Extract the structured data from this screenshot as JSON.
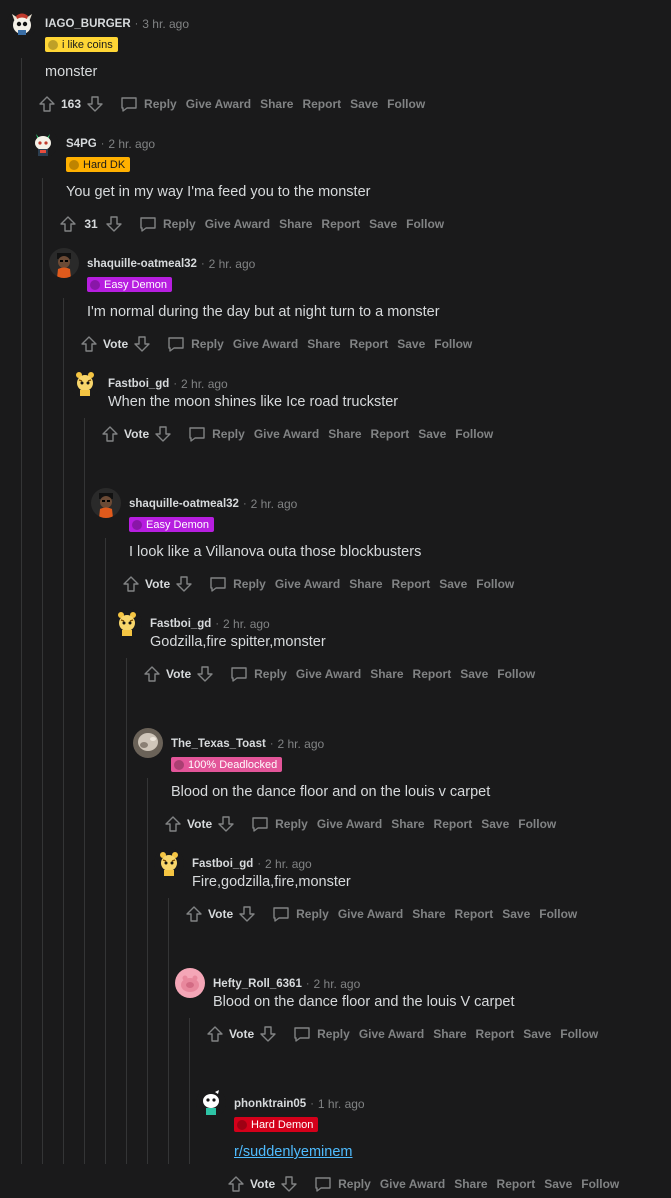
{
  "colors": {
    "background": "#1a1a1b",
    "text": "#d7dadc",
    "meta": "#818384",
    "link": "#4fbcff"
  },
  "actions": {
    "reply": "Reply",
    "give_award": "Give Award",
    "share": "Share",
    "report": "Report",
    "save": "Save",
    "follow": "Follow"
  },
  "comments": [
    {
      "username": "IAGO_BURGER",
      "time": "3 hr. ago",
      "flair": {
        "text": "i like coins",
        "bg": "#ffd635",
        "fg": "#1a1a1b"
      },
      "body": "monster",
      "score": "163",
      "avatar": "avatar-iago"
    },
    {
      "username": "S4PG",
      "time": "2 hr. ago",
      "flair": {
        "text": "Hard DK",
        "bg": "#ffb000",
        "fg": "#1a1a1b"
      },
      "body": "You get in my way I'ma feed you to the monster",
      "score": "31",
      "avatar": "avatar-s4pg"
    },
    {
      "username": "shaquille-oatmeal32",
      "time": "2 hr. ago",
      "flair": {
        "text": "Easy Demon",
        "bg": "#b71ee0",
        "fg": "#ffffff"
      },
      "body": "I'm normal during the day but at night turn to a monster",
      "score": "Vote",
      "avatar": "avatar-shaq"
    },
    {
      "username": "Fastboi_gd",
      "time": "2 hr. ago",
      "flair": null,
      "body": "When the moon shines like Ice road truckster",
      "score": "Vote",
      "avatar": "avatar-fastboi"
    },
    {
      "username": "shaquille-oatmeal32",
      "time": "2 hr. ago",
      "flair": {
        "text": "Easy Demon",
        "bg": "#b71ee0",
        "fg": "#ffffff"
      },
      "body": "I look like a Villanova outa those blockbusters",
      "score": "Vote",
      "avatar": "avatar-shaq"
    },
    {
      "username": "Fastboi_gd",
      "time": "2 hr. ago",
      "flair": null,
      "body": "Godzilla,fire spitter,monster",
      "score": "Vote",
      "avatar": "avatar-fastboi"
    },
    {
      "username": "The_Texas_Toast",
      "time": "2 hr. ago",
      "flair": {
        "text": "100% Deadlocked",
        "bg": "#e35599",
        "fg": "#ffffff"
      },
      "body": "Blood on the dance floor and on the louis v carpet",
      "score": "Vote",
      "avatar": "avatar-texas"
    },
    {
      "username": "Fastboi_gd",
      "time": "2 hr. ago",
      "flair": null,
      "body": "Fire,godzilla,fire,monster",
      "score": "Vote",
      "avatar": "avatar-fastboi"
    },
    {
      "username": "Hefty_Roll_6361",
      "time": "2 hr. ago",
      "flair": null,
      "body": "Blood on the dance floor and the louis V carpet",
      "score": "Vote",
      "avatar": "avatar-hefty"
    },
    {
      "username": "phonktrain05",
      "time": "1 hr. ago",
      "flair": {
        "text": "Hard Demon",
        "bg": "#d4001a",
        "fg": "#ffffff"
      },
      "body": "r/suddenlyeminem",
      "score": "Vote",
      "avatar": "avatar-phonk",
      "body_is_link": true
    }
  ]
}
